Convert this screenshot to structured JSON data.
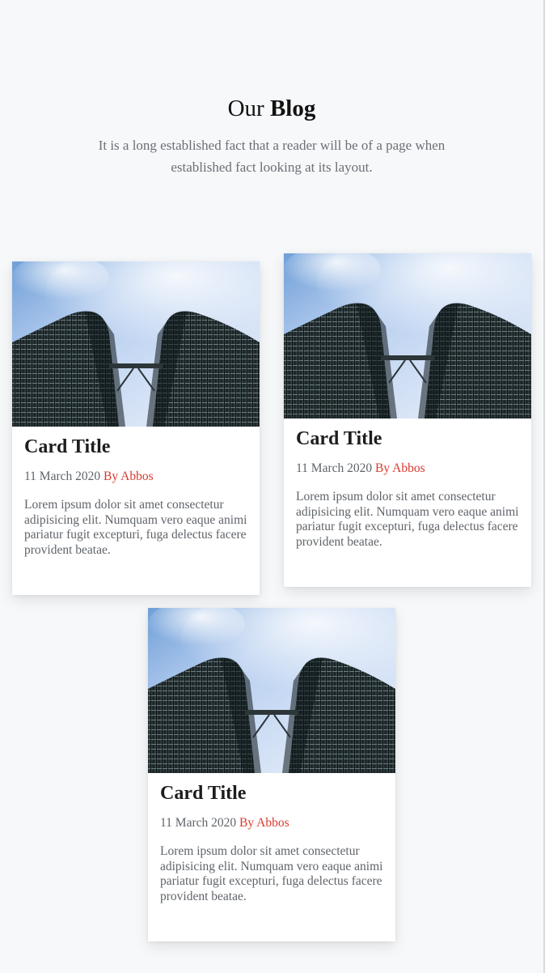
{
  "header": {
    "title_prefix": "Our",
    "title_strong": "Blog",
    "subtitle": "It is a long established fact that a reader will be of a page when established fact looking at its layout."
  },
  "colors": {
    "background": "#f6f8fa",
    "author": "#d83a2e",
    "muted_text": "#5f646a"
  },
  "cards": [
    {
      "image": "petronas-towers-photo",
      "title": "Card Title",
      "date": "11 March 2020",
      "author": "By Abbos",
      "text": "Lorem ipsum dolor sit amet consectetur adipisicing elit. Numquam vero eaque animi pariatur fugit excepturi, fuga delectus facere provident beatae."
    },
    {
      "image": "petronas-towers-photo",
      "title": "Card Title",
      "date": "11 March 2020",
      "author": "By Abbos",
      "text": "Lorem ipsum dolor sit amet consectetur adipisicing elit. Numquam vero eaque animi pariatur fugit excepturi, fuga delectus facere provident beatae."
    },
    {
      "image": "petronas-towers-photo",
      "title": "Card Title",
      "date": "11 March 2020",
      "author": "By Abbos",
      "text": "Lorem ipsum dolor sit amet consectetur adipisicing elit. Numquam vero eaque animi pariatur fugit excepturi, fuga delectus facere provident beatae."
    }
  ]
}
